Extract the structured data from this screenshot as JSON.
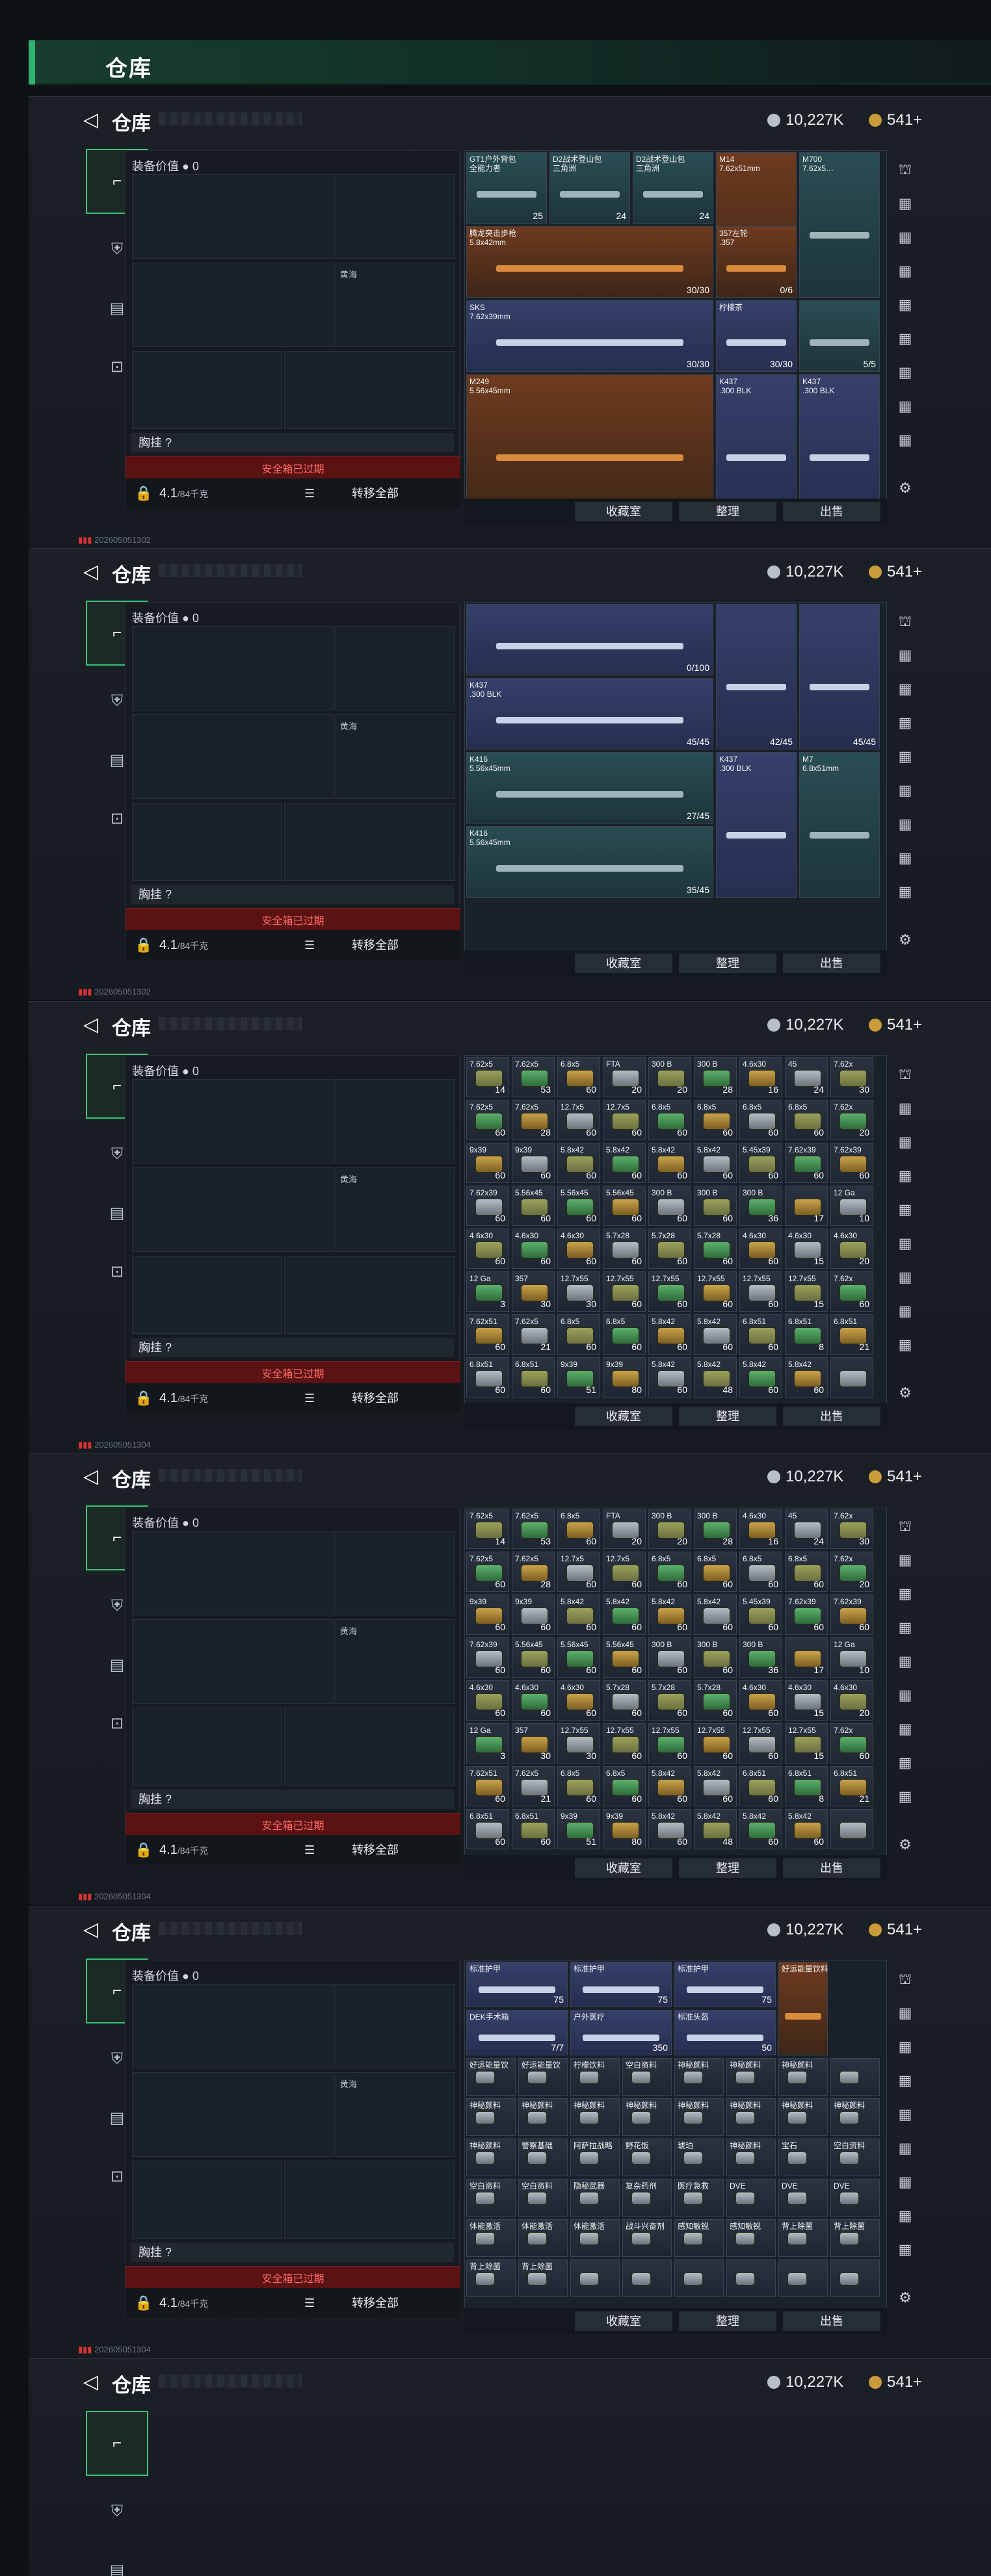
{
  "topbar": {
    "title": "仓库"
  },
  "header": {
    "title": "仓库",
    "silver": "10,227K",
    "gold": "541+"
  },
  "equip": {
    "value_label": "装备价值",
    "value": "0",
    "secure": "黄海",
    "chest": "胸挂 ?",
    "warning": "安全箱已过期",
    "capacity": "4.1",
    "capacity_total": "/84千克",
    "transfer_all": "转移全部"
  },
  "bottom": {
    "collect": "收藏室",
    "sort": "整理",
    "sell": "出售"
  },
  "status_ids": [
    "202605051302",
    "202605051302",
    "202605051304",
    "202605051304",
    "202605051304",
    ""
  ],
  "panels": [
    {
      "cells": [
        {
          "n": "GT1户外背包\n全能力者",
          "q": "25",
          "c": "teal",
          "x": 0,
          "y": 0,
          "w": 1,
          "h": 1
        },
        {
          "n": "D2战术登山包\n三角洲",
          "q": "24",
          "c": "teal",
          "x": 1,
          "y": 0,
          "w": 1,
          "h": 1
        },
        {
          "n": "D2战术登山包\n三角洲",
          "q": "24",
          "c": "teal",
          "x": 2,
          "y": 0,
          "w": 1,
          "h": 1
        },
        {
          "n": "M14\n7.62x51mm",
          "q": "",
          "c": "orange",
          "x": 3,
          "y": 0,
          "w": 1,
          "h": 2
        },
        {
          "n": "M700\n7.62x5…",
          "q": "",
          "c": "teal",
          "x": 4,
          "y": 0,
          "w": 1,
          "h": 2
        },
        {
          "n": "腾龙突击步枪\n5.8x42mm",
          "q": "30/30",
          "c": "orange",
          "x": 0,
          "y": 1,
          "w": 3,
          "h": 1
        },
        {
          "n": "357左轮\n.357",
          "q": "0/6",
          "c": "orange",
          "x": 3,
          "y": 1,
          "w": 1,
          "h": 1
        },
        {
          "n": "柠檬茶",
          "q": "30/30",
          "c": "blue",
          "x": 3,
          "y": 2,
          "w": 1,
          "h": 1
        },
        {
          "n": "",
          "q": "5/5",
          "c": "teal",
          "x": 4,
          "y": 2,
          "w": 1,
          "h": 1
        },
        {
          "n": "SKS\n7.62x39mm",
          "q": "30/30",
          "c": "blue",
          "x": 0,
          "y": 2,
          "w": 3,
          "h": 1
        },
        {
          "n": "K437\n.300 BLK",
          "q": "",
          "c": "blue",
          "x": 3,
          "y": 3,
          "w": 1,
          "h": 2
        },
        {
          "n": "K437\n.300 BLK",
          "q": "",
          "c": "blue",
          "x": 4,
          "y": 3,
          "w": 1,
          "h": 2
        },
        {
          "n": "M249\n5.56x45mm",
          "q": "",
          "c": "orange",
          "x": 0,
          "y": 3,
          "w": 3,
          "h": 2
        }
      ]
    },
    {
      "cells": [
        {
          "n": "",
          "q": "0/100",
          "c": "blue",
          "x": 0,
          "y": 0,
          "w": 3,
          "h": 1
        },
        {
          "n": "",
          "q": "42/45",
          "c": "blue",
          "x": 3,
          "y": 0,
          "w": 1,
          "h": 2
        },
        {
          "n": "",
          "q": "45/45",
          "c": "blue",
          "x": 4,
          "y": 0,
          "w": 1,
          "h": 2
        },
        {
          "n": "K437\n.300 BLK",
          "q": "45/45",
          "c": "blue",
          "x": 0,
          "y": 1,
          "w": 3,
          "h": 1
        },
        {
          "n": "K416\n5.56x45mm",
          "q": "27/45",
          "c": "teal",
          "x": 0,
          "y": 2,
          "w": 3,
          "h": 1
        },
        {
          "n": "K437\n.300 BLK",
          "q": "",
          "c": "blue",
          "x": 3,
          "y": 2,
          "w": 1,
          "h": 2
        },
        {
          "n": "M7\n6.8x51mm",
          "q": "",
          "c": "teal",
          "x": 4,
          "y": 2,
          "w": 1,
          "h": 2
        },
        {
          "n": "K416\n5.56x45mm",
          "q": "35/45",
          "c": "teal",
          "x": 0,
          "y": 3,
          "w": 3,
          "h": 1
        }
      ]
    },
    {
      "ammo": [
        [
          "7.62x5",
          "7.62x5",
          "6.8x5",
          "FTA",
          "300 B",
          "300 B",
          "4.6x30",
          "45 ",
          "7.62x"
        ],
        [
          "7.62x5",
          "7.62x5",
          "12.7x5",
          "12.7x5",
          "6.8x5",
          "6.8x5",
          "6.8x5",
          "6.8x5",
          "7.62x"
        ],
        [
          "9x39",
          "9x39",
          "5.8x42",
          "5.8x42",
          "5.8x42",
          "5.8x42",
          "5.45x39",
          "7.62x39",
          "7.62x39"
        ],
        [
          "7.62x39",
          "5.56x45",
          "5.56x45",
          "5.56x45",
          "300 B",
          "300 B",
          "300 B",
          "",
          "12 Ga"
        ],
        [
          "4.6x30",
          "4.6x30",
          "4.6x30",
          "5.7x28",
          "5.7x28",
          "5.7x28",
          "4.6x30",
          "4.6x30",
          "4.6x30"
        ],
        [
          "12 Ga",
          "357",
          "12.7x55",
          "12.7x55",
          "12.7x55",
          "12.7x55",
          "12.7x55",
          "12.7x55",
          "7.62x"
        ],
        [
          "7.62x51",
          "7.62x5",
          "6.8x5",
          "6.8x5",
          "5.8x42",
          "5.8x42",
          "6.8x51",
          "6.8x51",
          "6.8x51"
        ],
        [
          "6.8x51",
          "6.8x51",
          "9x39",
          "9x39",
          "5.8x42",
          "5.8x42",
          "5.8x42",
          "5.8x42",
          ""
        ]
      ],
      "qty": [
        [
          "14",
          "53",
          "60",
          "20",
          "20",
          "28",
          "16",
          "24",
          "30"
        ],
        [
          "60",
          "28",
          "60",
          "60",
          "60",
          "60",
          "60",
          "60",
          "20"
        ],
        [
          "60",
          "60",
          "60",
          "60",
          "60",
          "60",
          "60",
          "60",
          "60"
        ],
        [
          "60",
          "60",
          "60",
          "60",
          "60",
          "60",
          "36",
          "17",
          "10"
        ],
        [
          "60",
          "60",
          "60",
          "60",
          "60",
          "60",
          "60",
          "15",
          "20"
        ],
        [
          "3",
          "30",
          "30",
          "60",
          "60",
          "60",
          "60",
          "15",
          "60"
        ],
        [
          "60",
          "21",
          "60",
          "60",
          "60",
          "60",
          "60",
          "8",
          "21"
        ],
        [
          "60",
          "60",
          "51",
          "80",
          "60",
          "48",
          "60",
          "60",
          ""
        ]
      ]
    },
    {
      "ammo_ref": 2
    },
    {
      "cells": [
        {
          "n": "标准护甲",
          "q": "75",
          "c": "blue",
          "x": 0,
          "y": 0,
          "w": 2,
          "h": 1
        },
        {
          "n": "标准护甲",
          "q": "75",
          "c": "blue",
          "x": 2,
          "y": 0,
          "w": 2,
          "h": 1
        },
        {
          "n": "标准护甲",
          "q": "75",
          "c": "blue",
          "x": 4,
          "y": 0,
          "w": 2,
          "h": 1
        },
        {
          "n": "DEK手术箱",
          "q": "7/7",
          "c": "blue",
          "x": 0,
          "y": 1,
          "w": 2,
          "h": 1
        },
        {
          "n": "户外医疗",
          "q": "350",
          "c": "blue",
          "x": 2,
          "y": 1,
          "w": 2,
          "h": 1
        },
        {
          "n": "标准头盔",
          "q": "50",
          "c": "blue",
          "x": 4,
          "y": 1,
          "w": 2,
          "h": 1
        },
        {
          "n": "好运能量饮料",
          "q": "",
          "c": "orange",
          "x": 6,
          "y": 0,
          "w": 1,
          "h": 2
        }
      ],
      "small": [
        [
          "好运能量饮",
          "好运能量饮",
          "柠檬饮料",
          "空白资料",
          "神秘颜料",
          "神秘颜料",
          "神秘颜料",
          ""
        ],
        [
          "神秘颜料",
          "神秘颜料",
          "神秘颜料",
          "神秘颜料",
          "神秘颜料",
          "神秘颜料",
          "神秘颜料",
          "神秘颜料"
        ],
        [
          "神秘颜料",
          "警察基础",
          "阿萨拉战略",
          "野花饭",
          "琥珀",
          "神秘颜料",
          "宝石",
          "空白资料"
        ],
        [
          "空白资料",
          "空白资料",
          "隐秘武器",
          "复杂药剂",
          "医疗急救",
          "DVE",
          "DVE",
          "DVE"
        ],
        [
          "体能激活",
          "体能激活",
          "体能激活",
          "战斗兴奋剂",
          "感知敏锐",
          "感知敏锐",
          "背上除菌",
          "背上除菌"
        ],
        [
          "背上除菌",
          "背上除菌",
          "",
          "",
          "",
          "",
          "",
          ""
        ]
      ]
    },
    {
      "cells_ref": 4
    }
  ]
}
